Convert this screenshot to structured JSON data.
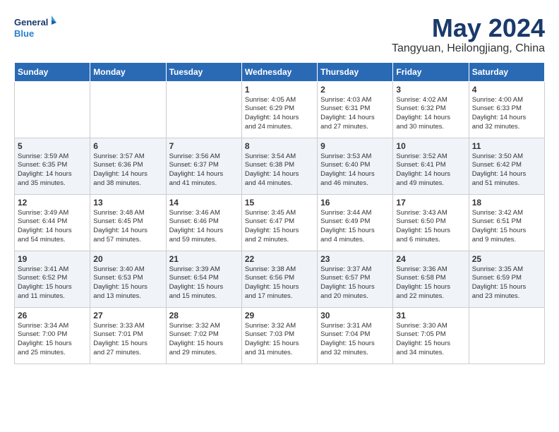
{
  "logo": {
    "line1": "General",
    "line2": "Blue"
  },
  "title": "May 2024",
  "subtitle": "Tangyuan, Heilongjiang, China",
  "days_of_week": [
    "Sunday",
    "Monday",
    "Tuesday",
    "Wednesday",
    "Thursday",
    "Friday",
    "Saturday"
  ],
  "weeks": [
    [
      {
        "day": "",
        "info": ""
      },
      {
        "day": "",
        "info": ""
      },
      {
        "day": "",
        "info": ""
      },
      {
        "day": "1",
        "info": "Sunrise: 4:05 AM\nSunset: 6:29 PM\nDaylight: 14 hours\nand 24 minutes."
      },
      {
        "day": "2",
        "info": "Sunrise: 4:03 AM\nSunset: 6:31 PM\nDaylight: 14 hours\nand 27 minutes."
      },
      {
        "day": "3",
        "info": "Sunrise: 4:02 AM\nSunset: 6:32 PM\nDaylight: 14 hours\nand 30 minutes."
      },
      {
        "day": "4",
        "info": "Sunrise: 4:00 AM\nSunset: 6:33 PM\nDaylight: 14 hours\nand 32 minutes."
      }
    ],
    [
      {
        "day": "5",
        "info": "Sunrise: 3:59 AM\nSunset: 6:35 PM\nDaylight: 14 hours\nand 35 minutes."
      },
      {
        "day": "6",
        "info": "Sunrise: 3:57 AM\nSunset: 6:36 PM\nDaylight: 14 hours\nand 38 minutes."
      },
      {
        "day": "7",
        "info": "Sunrise: 3:56 AM\nSunset: 6:37 PM\nDaylight: 14 hours\nand 41 minutes."
      },
      {
        "day": "8",
        "info": "Sunrise: 3:54 AM\nSunset: 6:38 PM\nDaylight: 14 hours\nand 44 minutes."
      },
      {
        "day": "9",
        "info": "Sunrise: 3:53 AM\nSunset: 6:40 PM\nDaylight: 14 hours\nand 46 minutes."
      },
      {
        "day": "10",
        "info": "Sunrise: 3:52 AM\nSunset: 6:41 PM\nDaylight: 14 hours\nand 49 minutes."
      },
      {
        "day": "11",
        "info": "Sunrise: 3:50 AM\nSunset: 6:42 PM\nDaylight: 14 hours\nand 51 minutes."
      }
    ],
    [
      {
        "day": "12",
        "info": "Sunrise: 3:49 AM\nSunset: 6:44 PM\nDaylight: 14 hours\nand 54 minutes."
      },
      {
        "day": "13",
        "info": "Sunrise: 3:48 AM\nSunset: 6:45 PM\nDaylight: 14 hours\nand 57 minutes."
      },
      {
        "day": "14",
        "info": "Sunrise: 3:46 AM\nSunset: 6:46 PM\nDaylight: 14 hours\nand 59 minutes."
      },
      {
        "day": "15",
        "info": "Sunrise: 3:45 AM\nSunset: 6:47 PM\nDaylight: 15 hours\nand 2 minutes."
      },
      {
        "day": "16",
        "info": "Sunrise: 3:44 AM\nSunset: 6:49 PM\nDaylight: 15 hours\nand 4 minutes."
      },
      {
        "day": "17",
        "info": "Sunrise: 3:43 AM\nSunset: 6:50 PM\nDaylight: 15 hours\nand 6 minutes."
      },
      {
        "day": "18",
        "info": "Sunrise: 3:42 AM\nSunset: 6:51 PM\nDaylight: 15 hours\nand 9 minutes."
      }
    ],
    [
      {
        "day": "19",
        "info": "Sunrise: 3:41 AM\nSunset: 6:52 PM\nDaylight: 15 hours\nand 11 minutes."
      },
      {
        "day": "20",
        "info": "Sunrise: 3:40 AM\nSunset: 6:53 PM\nDaylight: 15 hours\nand 13 minutes."
      },
      {
        "day": "21",
        "info": "Sunrise: 3:39 AM\nSunset: 6:54 PM\nDaylight: 15 hours\nand 15 minutes."
      },
      {
        "day": "22",
        "info": "Sunrise: 3:38 AM\nSunset: 6:56 PM\nDaylight: 15 hours\nand 17 minutes."
      },
      {
        "day": "23",
        "info": "Sunrise: 3:37 AM\nSunset: 6:57 PM\nDaylight: 15 hours\nand 20 minutes."
      },
      {
        "day": "24",
        "info": "Sunrise: 3:36 AM\nSunset: 6:58 PM\nDaylight: 15 hours\nand 22 minutes."
      },
      {
        "day": "25",
        "info": "Sunrise: 3:35 AM\nSunset: 6:59 PM\nDaylight: 15 hours\nand 23 minutes."
      }
    ],
    [
      {
        "day": "26",
        "info": "Sunrise: 3:34 AM\nSunset: 7:00 PM\nDaylight: 15 hours\nand 25 minutes."
      },
      {
        "day": "27",
        "info": "Sunrise: 3:33 AM\nSunset: 7:01 PM\nDaylight: 15 hours\nand 27 minutes."
      },
      {
        "day": "28",
        "info": "Sunrise: 3:32 AM\nSunset: 7:02 PM\nDaylight: 15 hours\nand 29 minutes."
      },
      {
        "day": "29",
        "info": "Sunrise: 3:32 AM\nSunset: 7:03 PM\nDaylight: 15 hours\nand 31 minutes."
      },
      {
        "day": "30",
        "info": "Sunrise: 3:31 AM\nSunset: 7:04 PM\nDaylight: 15 hours\nand 32 minutes."
      },
      {
        "day": "31",
        "info": "Sunrise: 3:30 AM\nSunset: 7:05 PM\nDaylight: 15 hours\nand 34 minutes."
      },
      {
        "day": "",
        "info": ""
      }
    ]
  ]
}
